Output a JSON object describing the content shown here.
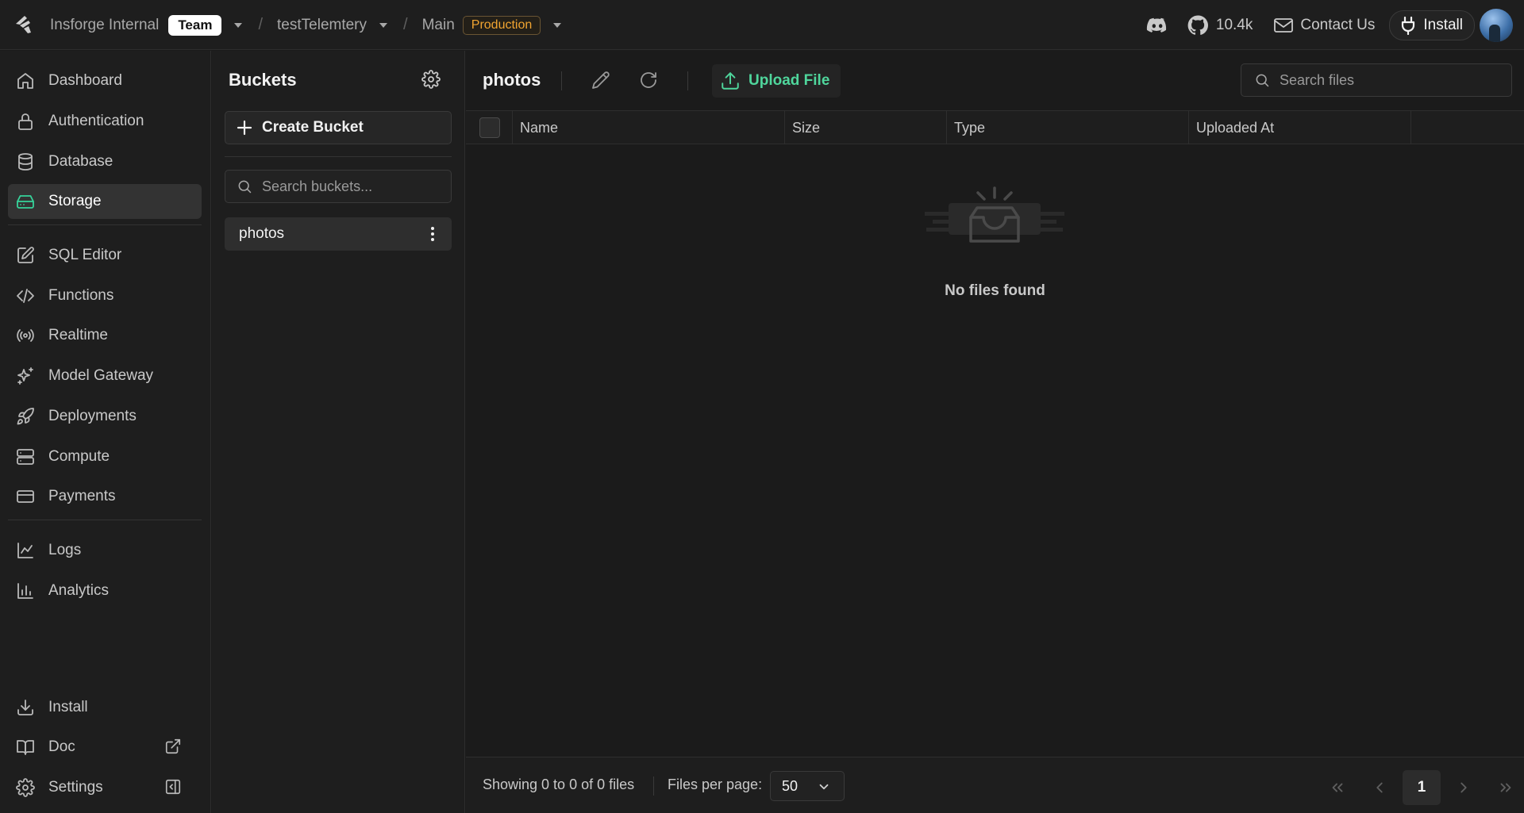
{
  "topbar": {
    "org": "Insforge Internal",
    "org_badge": "Team",
    "project": "testTelemtery",
    "branch": "Main",
    "env_badge": "Production",
    "github_stars": "10.4k",
    "contact": "Contact Us",
    "install": "Install",
    "icons": [
      "insforge-logo-icon",
      "discord-icon",
      "github-icon",
      "mail-icon",
      "plug-icon"
    ]
  },
  "sidebar": {
    "items": [
      {
        "label": "Dashboard",
        "icon": "home-icon"
      },
      {
        "label": "Authentication",
        "icon": "lock-icon"
      },
      {
        "label": "Database",
        "icon": "database-icon"
      },
      {
        "label": "Storage",
        "icon": "hard-drive-icon",
        "active": true
      },
      {
        "label": "SQL Editor",
        "icon": "edit-square-icon"
      },
      {
        "label": "Functions",
        "icon": "code-icon"
      },
      {
        "label": "Realtime",
        "icon": "radio-icon"
      },
      {
        "label": "Model Gateway",
        "icon": "sparkles-icon"
      },
      {
        "label": "Deployments",
        "icon": "rocket-icon"
      },
      {
        "label": "Compute",
        "icon": "server-icon"
      },
      {
        "label": "Payments",
        "icon": "credit-card-icon"
      },
      {
        "label": "Logs",
        "icon": "line-chart-icon"
      },
      {
        "label": "Analytics",
        "icon": "bar-chart-icon"
      }
    ],
    "bottom": [
      {
        "label": "Install",
        "icon": "download-icon"
      },
      {
        "label": "Doc",
        "icon": "book-icon"
      },
      {
        "label": "Settings",
        "icon": "settings-icon"
      }
    ]
  },
  "buckets": {
    "title": "Buckets",
    "create_label": "Create Bucket",
    "search_placeholder": "Search buckets...",
    "list": [
      "photos"
    ]
  },
  "main": {
    "title": "photos",
    "upload_label": "Upload File",
    "search_placeholder": "Search files",
    "columns": [
      "Name",
      "Size",
      "Type",
      "Uploaded At"
    ],
    "empty_message": "No files found",
    "footer": {
      "showing": "Showing 0 to 0 of 0 files",
      "per_page_label": "Files per page:",
      "per_page_value": "50",
      "current_page": "1"
    }
  },
  "colors": {
    "accent": "#36d39a",
    "env_badge": "#f0a431",
    "background": "#1b1b1b"
  }
}
